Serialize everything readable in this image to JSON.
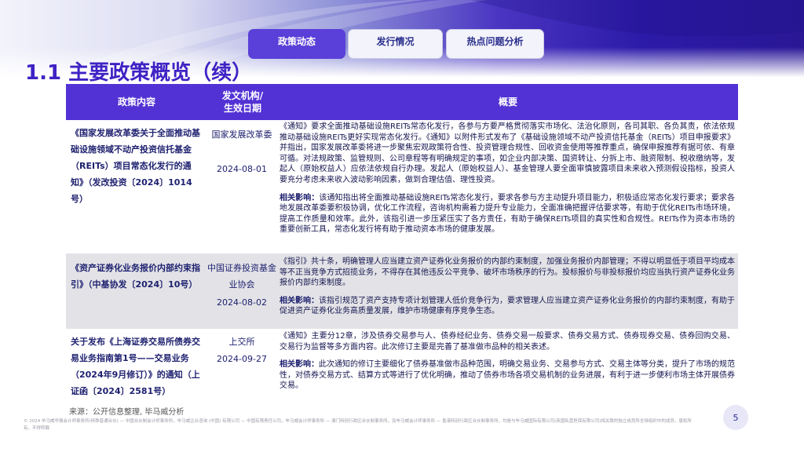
{
  "tabs": [
    {
      "label": "政策动态",
      "active": true
    },
    {
      "label": "发行情况",
      "active": false
    },
    {
      "label": "热点问题分析",
      "active": false
    }
  ],
  "page_title": "1.1 主要政策概览（续）",
  "table": {
    "headers": [
      "政策内容",
      "发文机构/\n生效日期",
      "概要"
    ],
    "rows": [
      {
        "policy": "《国家发展改革委关于全面推动基础设施领域不动产投资信托基金（REITs）项目常态化发行的通知》（发改投资〔2024〕1014号）",
        "agency": "国家发展改革委",
        "date": "2024-08-01",
        "summary": "《通知》要求全面推动基础设施REITs常态化发行，各参与方要严格贯彻落实市场化、法治化原则，各司其职、各负其责，依法依规推动基础设施REITs更好实现常态化发行。《通知》以附件形式发布了《基础设施领域不动产投资信托基金（REITs）项目申报要求》并指出，国家发展改革委将进一步聚焦宏观政策符合性、投资管理合规性、回收资金使用等推荐重点，确保申报推荐有据可依、有章可循。对法规政策、监管规则、公司章程等有明确规定的事项，如企业内部决策、国资转让、分拆上市、融资限制、税收缴纳等，发起人（原始权益人）应依法依规自行办理。发起人（原始权益人）、基金管理人要全面审慎披露项目未来收入预测假设指标，投资人要充分考虑未来收入波动影响因素，做到合理估值、理性投资。",
        "impact_label": "相关影响：",
        "impact": "该通知指出将全面推动基础设施REITs常态化发行，要求各参与方主动提升项目能力，积极适应常态化发行要求；要求各地发展改革委要积极协调，优化工作流程，咨询机构需着力提升专业能力，全面准确把握评估要求等，有助于优化REITs市场环境，提高工作质量和效率。此外，该指引进一步压紧压实了各方责任，有助于确保REITs项目的真实性和合规性。REITs作为资本市场的重要创新工具，常态化发行将有助于推动资本市场的健康发展。"
      },
      {
        "policy": "《资产证券化业务报价内部约束指引》（中基协发〔2024〕10号）",
        "agency": "中国证券投资基金业协会",
        "date": "2024-08-02",
        "summary": "《指引》共十条，明确管理人应当建立资产证券化业务报价的内部约束制度，加强业务报价内部管理；不得以明显低于项目平均成本等不正当竞争方式招揽业务，不得存在其他违反公平竞争、破坏市场秩序的行为。投标报价与非投标报价均应当执行资产证券化业务报价内部约束制度。",
        "impact_label": "相关影响：",
        "impact": "该指引规范了资产支持专项计划管理人低价竞争行为，要求管理人应当建立资产证券化业务报价的内部约束制度，有助于促进资产证券化业务高质量发展，维护市场健康有序竞争生态。"
      },
      {
        "policy": "关于发布《上海证券交易所债券交易业务指南第1号——交易业务（2024年9月修订）》的通知（上证函〔2024〕2581号）",
        "agency": "上交所",
        "date": "2024-09-27",
        "summary": "《通知》主要分12章，涉及债券交易参与人、债券经纪业务、债券交易一般要求、债券交易方式、债券现券交易、债券回购交易、交易行为监督等多方面内容。此次修订主要是完善了基准做市品种的相关表述。",
        "impact_label": "相关影响：",
        "impact": "此次通知的修订主要细化了债券基准做市品种范围，明确交易业务、交易参与方式、交易主体等分类，提升了市场的规范性，对债券交易方式、结算方式等进行了优化明确，推动了债券市场各项交易机制的业务进展，有利于进一步便利市场主体开展债券交易。"
      }
    ]
  },
  "source": "来源：公开信息整理, 毕马威分析",
  "page_number": "5",
  "footer": "© 2024 毕马威华振会计师事务所(特殊普通合伙) — 中国合伙制会计师事务所，毕马威企业咨询 (中国) 有限公司 — 中国有限责任公司，毕马威会计师事务所 — 澳门特别行政区合伙制事务所，及毕马威会计师事务所 — 香港特别行政区合伙制事务所，均是与毕马威国际有限公司(英国私营担保有限公司)相关联的独立成员所全球组织中的成员。版权所有，不得转载"
}
